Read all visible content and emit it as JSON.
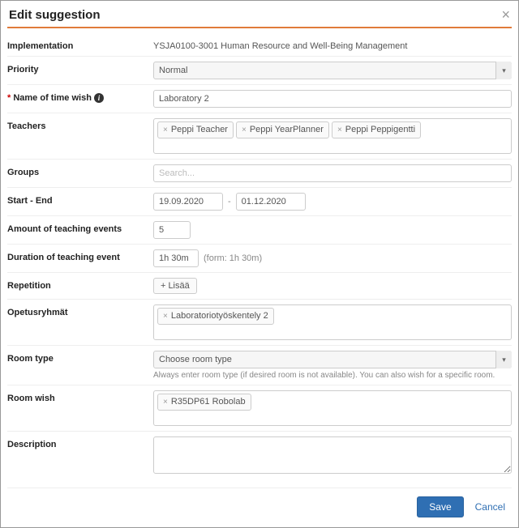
{
  "modal": {
    "title": "Edit suggestion",
    "close": "×"
  },
  "labels": {
    "implementation": "Implementation",
    "priority": "Priority",
    "name_of_time_wish": "Name of time wish",
    "teachers": "Teachers",
    "groups": "Groups",
    "start_end": "Start - End",
    "amount_events": "Amount of teaching events",
    "duration_event": "Duration of teaching event",
    "repetition": "Repetition",
    "opetusryhmat": "Opetusryhmät",
    "room_type": "Room type",
    "room_wish": "Room wish",
    "description": "Description"
  },
  "fields": {
    "implementation_value": "YSJA0100-3001 Human Resource and Well-Being Management",
    "priority_value": "Normal",
    "name_value": "Laboratory 2",
    "teachers": [
      "Peppi Teacher",
      "Peppi YearPlanner",
      "Peppi Peppigentti"
    ],
    "groups_placeholder": "Search...",
    "start_date": "19.09.2020",
    "end_date": "01.12.2020",
    "amount_value": "5",
    "duration_value": "1h 30m",
    "duration_hint": "(form: 1h 30m)",
    "repetition_add": "Lisää",
    "opetusryhmat_tags": [
      "Laboratoriotyöskentely 2"
    ],
    "room_type_value": "Choose room type",
    "room_type_hint": "Always enter room type (if desired room is not available). You can also wish for a specific room.",
    "room_wish_tags": [
      "R35DP61 Robolab"
    ],
    "description_value": ""
  },
  "footer": {
    "save": "Save",
    "cancel": "Cancel"
  },
  "icons": {
    "info": "i",
    "plus": "+",
    "remove": "×",
    "caret": "▾",
    "dash": "-"
  }
}
